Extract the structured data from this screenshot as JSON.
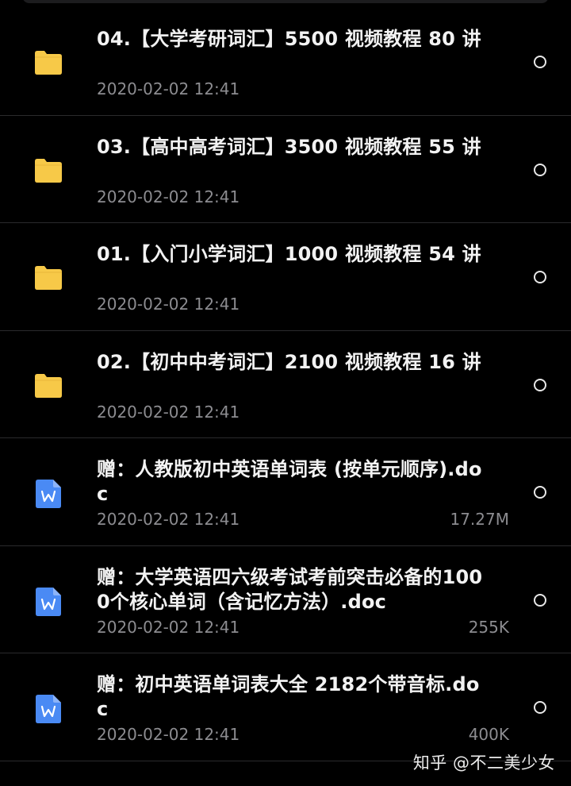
{
  "files": [
    {
      "type": "folder",
      "icon": "folder-icon",
      "name": "04.【大学考研词汇】5500 视频教程 80 讲",
      "date": "2020-02-02 12:41",
      "size": ""
    },
    {
      "type": "folder",
      "icon": "folder-icon",
      "name": "03.【高中高考词汇】3500 视频教程 55 讲",
      "date": "2020-02-02 12:41",
      "size": ""
    },
    {
      "type": "folder",
      "icon": "folder-icon",
      "name": "01.【入门小学词汇】1000 视频教程 54 讲",
      "date": "2020-02-02 12:41",
      "size": ""
    },
    {
      "type": "folder",
      "icon": "folder-icon",
      "name": "02.【初中中考词汇】2100 视频教程 16 讲",
      "date": "2020-02-02 12:41",
      "size": ""
    },
    {
      "type": "doc",
      "icon": "word-doc-icon",
      "name": "赠：人教版初中英语单词表 (按单元顺序).doc",
      "date": "2020-02-02 12:41",
      "size": "17.27M"
    },
    {
      "type": "doc",
      "icon": "word-doc-icon",
      "name": "赠：大学英语四六级考试考前突击必备的1000个核心单词（含记忆方法）.doc",
      "date": "2020-02-02 12:41",
      "size": "255K"
    },
    {
      "type": "doc",
      "icon": "word-doc-icon",
      "name": "赠：初中英语单词表大全 2182个带音标.doc",
      "date": "2020-02-02 12:41",
      "size": "400K"
    }
  ],
  "watermark": {
    "text": "知乎 @不二美少女"
  },
  "colors": {
    "background": "#000000",
    "folder": "#f7c948",
    "word_doc": "#4a8af4",
    "divider": "#2a2a2c",
    "secondary_text": "#8c8c90"
  }
}
